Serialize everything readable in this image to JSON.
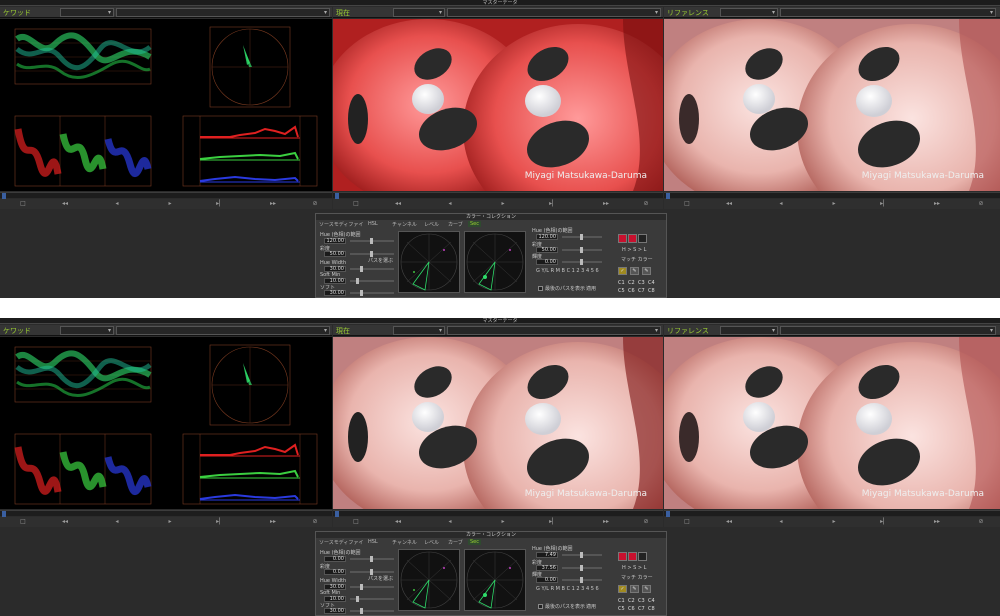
{
  "window_title": "マスターデータ",
  "screens": [
    {
      "panels": {
        "scopes": {
          "label": "ケワッド"
        },
        "current": {
          "label": "現在"
        },
        "reference": {
          "label": "リファレンス"
        }
      },
      "watermark_current": "Miyagi Matsukawa-Daruma",
      "watermark_reference": "Miyagi Matsukawa-Daruma",
      "color_corrector": {
        "title": "カラー・コレクション",
        "tabs": [
          "ソースモディファイ",
          "HSL",
          "チャンネル",
          "レベル",
          "カーブ",
          "Sec"
        ],
        "hue_left_label": "Hue (色相)の範囲",
        "hue_left_value": "120.00",
        "sat_label": "彩度",
        "sat_value": "50.00",
        "hue_width_label": "Hue Width",
        "hue_width_value": "30.00",
        "soft_label": "Soft Min",
        "soft_value": "10.00",
        "soft2_label": "ソフト",
        "soft2_value": "30.00",
        "eyedropper_label": "パスを選ぶ",
        "hue_right_label": "Hue (色相)の範囲",
        "hue_right_value": "120.00",
        "sat_right_label": "彩度",
        "sat_right_value": "50.00",
        "lum_right_label": "輝度",
        "lum_right_value": "0.00",
        "range_row": "G Y/L R M B C 1 2 3 4 5 6",
        "mode_label": "H > S > L",
        "match_label": "マッチ カラー",
        "check_label": "最後のパスを表示",
        "preset_label": "適用",
        "c_buttons": [
          "C1",
          "C2",
          "C3",
          "C4",
          "C5",
          "C6",
          "C7",
          "C8"
        ],
        "accent_red": "#c8102e"
      }
    },
    {
      "panels": {
        "scopes": {
          "label": "ケワッド"
        },
        "current": {
          "label": "現在"
        },
        "reference": {
          "label": "リファレンス"
        }
      },
      "watermark_current": "Miyagi Matsukawa-Daruma",
      "watermark_reference": "Miyagi Matsukawa-Daruma",
      "color_corrector": {
        "title": "カラー・コレクション",
        "tabs": [
          "ソースモディファイ",
          "HSL",
          "チャンネル",
          "レベル",
          "カーブ",
          "Sec"
        ],
        "hue_left_label": "Hue (色相)の範囲",
        "hue_left_value": "0.00",
        "sat_label": "彩度",
        "sat_value": "0.00",
        "hue_width_label": "Hue Width",
        "hue_width_value": "30.00",
        "soft_label": "Soft Min",
        "soft_value": "10.00",
        "soft2_label": "ソフト",
        "soft2_value": "30.00",
        "eyedropper_label": "パスを選ぶ",
        "hue_right_label": "Hue (色相)の範囲",
        "hue_right_value": "7.49",
        "sat_right_label": "彩度",
        "sat_right_value": "37.56",
        "lum_right_label": "輝度",
        "lum_right_value": "0.00",
        "range_row": "G Y/L R M B C 1 2 3 4 5 6",
        "mode_label": "H > S > L",
        "match_label": "マッチ カラー",
        "check_label": "最後のパスを表示",
        "preset_label": "適用",
        "c_buttons": [
          "C1",
          "C2",
          "C3",
          "C4",
          "C5",
          "C6",
          "C7",
          "C8"
        ],
        "accent_red": "#c8102e"
      }
    }
  ],
  "transport_icons": [
    "stop-icon",
    "rewind-icon",
    "step-back-icon",
    "play-icon",
    "step-forward-icon",
    "fast-forward-icon",
    "loop-icon"
  ]
}
